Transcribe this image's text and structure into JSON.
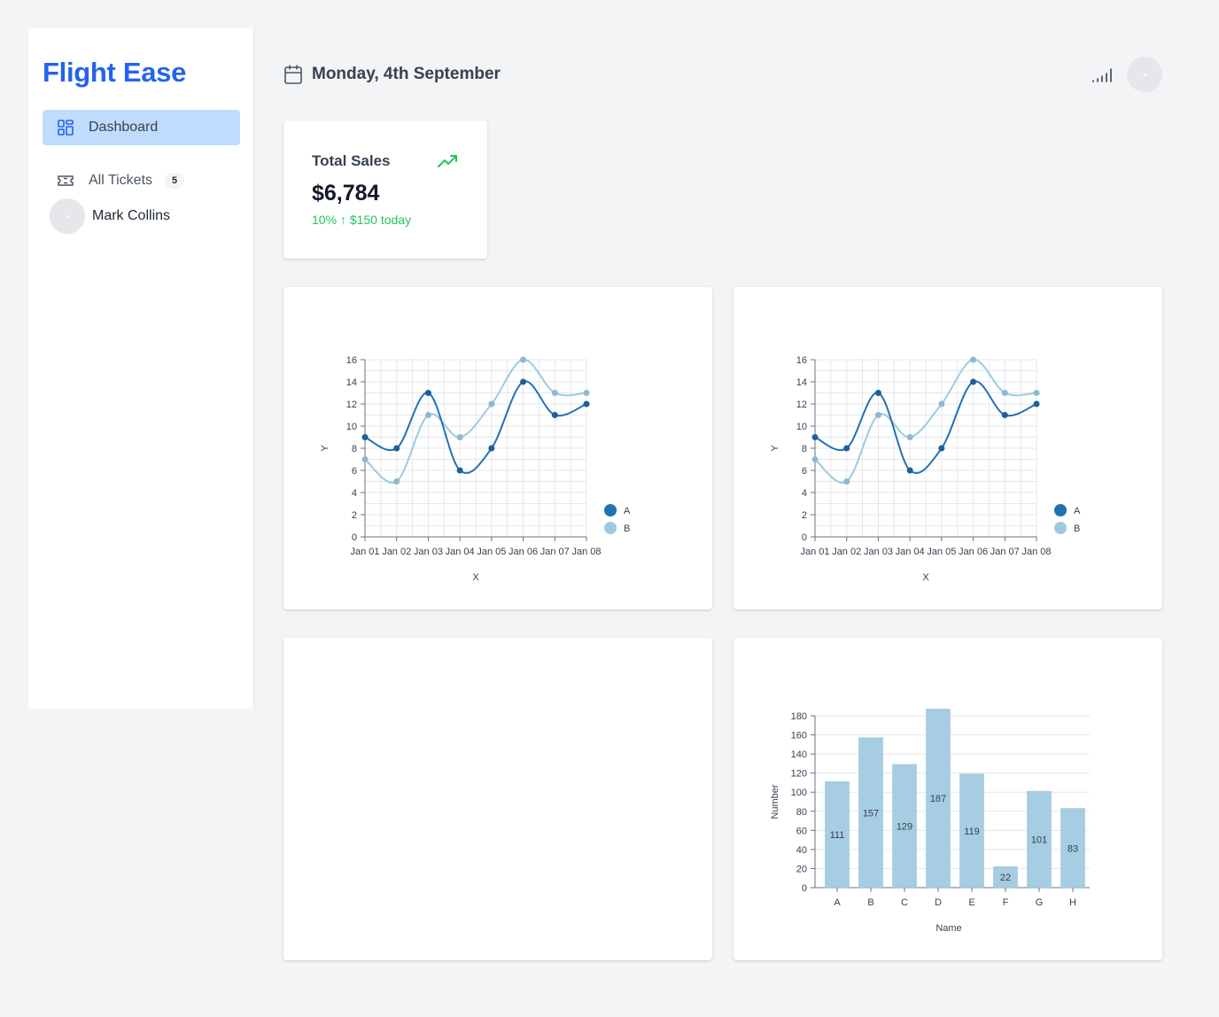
{
  "sidebar": {
    "brand": "Flight Ease",
    "items": [
      {
        "label": "Dashboard",
        "icon": "dashboard-grid-icon",
        "active": true
      },
      {
        "label": "All Tickets",
        "icon": "ticket-icon",
        "badge": "5"
      }
    ],
    "user": {
      "name": "Mark Collins"
    }
  },
  "header": {
    "date": "Monday, 4th September",
    "icons": [
      "calendar-icon",
      "signal-icon",
      "avatar"
    ]
  },
  "stats": {
    "title": "Total Sales",
    "value": "$6,784",
    "delta": "10% ↑ $150 today",
    "icon": "trending-up-icon",
    "accent": "#22c55e"
  },
  "colors": {
    "brand": "#2563eb",
    "series_a": "#2171b5",
    "series_b": "#9ecae1",
    "bar": "#a6cde2"
  },
  "chart_data": [
    {
      "type": "line",
      "x": [
        "Jan 01",
        "Jan 02",
        "Jan 03",
        "Jan 04",
        "Jan 05",
        "Jan 06",
        "Jan 07",
        "Jan 08"
      ],
      "series": [
        {
          "name": "A",
          "values": [
            9,
            8,
            13,
            6,
            8,
            14,
            11,
            12
          ]
        },
        {
          "name": "B",
          "values": [
            7,
            5,
            11,
            9,
            12,
            16,
            13,
            13
          ]
        }
      ],
      "xlabel": "X",
      "ylabel": "Y",
      "ylim": [
        0,
        16
      ],
      "yticks": [
        0,
        2,
        4,
        6,
        8,
        10,
        12,
        14,
        16
      ],
      "grid": true,
      "legend": "right"
    },
    {
      "type": "line",
      "x": [
        "Jan 01",
        "Jan 02",
        "Jan 03",
        "Jan 04",
        "Jan 05",
        "Jan 06",
        "Jan 07",
        "Jan 08"
      ],
      "series": [
        {
          "name": "A",
          "values": [
            9,
            8,
            13,
            6,
            8,
            14,
            11,
            12
          ]
        },
        {
          "name": "B",
          "values": [
            7,
            5,
            11,
            9,
            12,
            16,
            13,
            13
          ]
        }
      ],
      "xlabel": "X",
      "ylabel": "Y",
      "ylim": [
        0,
        16
      ],
      "yticks": [
        0,
        2,
        4,
        6,
        8,
        10,
        12,
        14,
        16
      ],
      "grid": true,
      "legend": "right"
    },
    {
      "type": "bar",
      "categories": [
        "A",
        "B",
        "C",
        "D",
        "E",
        "F",
        "G",
        "H"
      ],
      "values": [
        111,
        157,
        129,
        187,
        119,
        22,
        101,
        83
      ],
      "xlabel": "Name",
      "ylabel": "Number",
      "ylim": [
        0,
        180
      ],
      "yticks": [
        0,
        20,
        40,
        60,
        80,
        100,
        120,
        140,
        160,
        180
      ],
      "grid": true
    }
  ]
}
